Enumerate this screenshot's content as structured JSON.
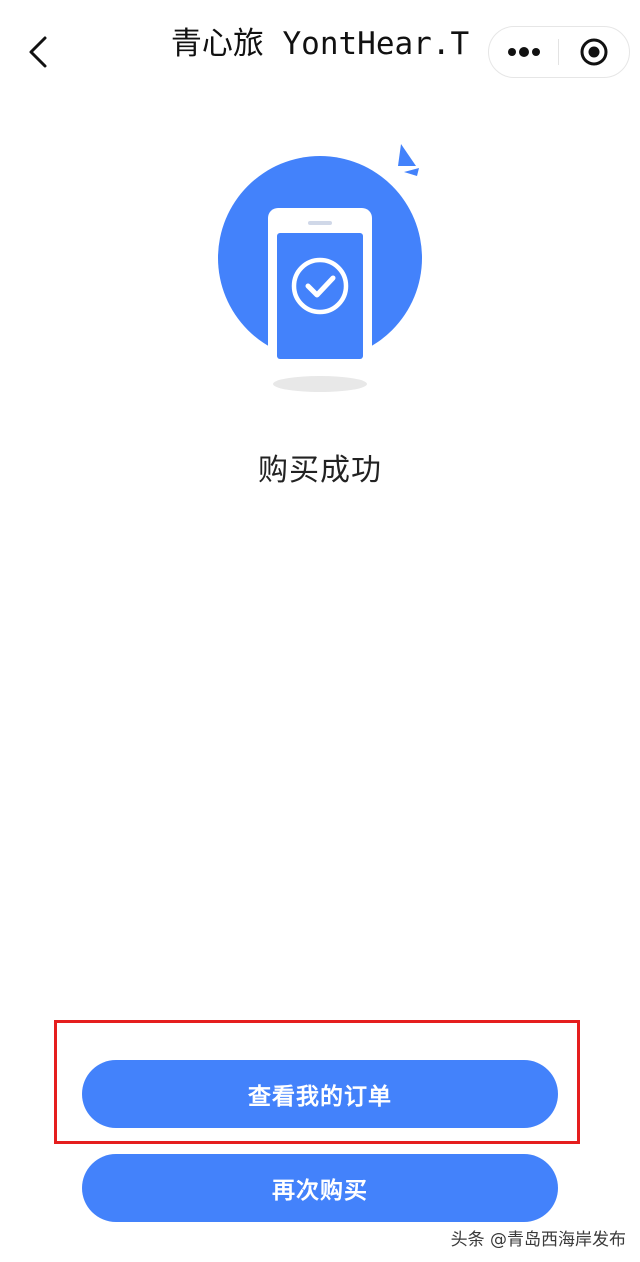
{
  "header": {
    "title": "青心旅 YontHear.T",
    "back_icon": "chevron-left-icon",
    "more_icon": "more-dots-icon",
    "close_icon": "target-close-icon"
  },
  "main": {
    "illustration_icon": "phone-checkmark-icon",
    "success_text": "购买成功"
  },
  "actions": {
    "view_orders_label": "查看我的订单",
    "buy_again_label": "再次购买"
  },
  "watermark": {
    "text": "头条 @青岛西海岸发布"
  },
  "colors": {
    "accent": "#4382fb",
    "highlight": "#e51e1e",
    "shadow": "#e8e8e8"
  }
}
